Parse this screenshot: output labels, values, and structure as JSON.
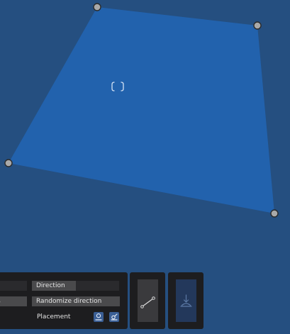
{
  "canvas": {
    "background_color": "#254f80",
    "shape_fill_color": "#2262ad",
    "shape_name": "quadrilateral",
    "vertex_count": 4,
    "center_icon": "focus-brackets-icon"
  },
  "toolbar": {
    "row1_left_value": "",
    "direction_label": "Direction",
    "direction_value": "",
    "row2_left_value": "s",
    "randomize_label": "Randomize direction",
    "placement_label": "Placement",
    "placement_icons": [
      "person-outline-icon",
      "person-direction-icon"
    ],
    "accent_color": "#3b5f95",
    "line_tool_icon": "line-segment-icon",
    "export_icon": "download-tray-icon"
  }
}
